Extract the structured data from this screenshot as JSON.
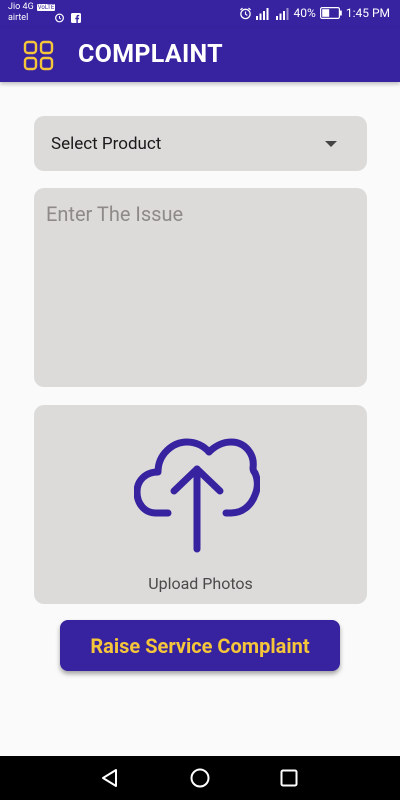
{
  "status_bar": {
    "carrier_1": "Jio 4G",
    "volte_badge": "VoLTE",
    "carrier_2": "airtel",
    "network_type": "4G",
    "battery_percent": "40%",
    "time": "1:45 PM"
  },
  "app_bar": {
    "title": "COMPLAINT",
    "menu_icon": "grid-icon"
  },
  "form": {
    "product_select": {
      "selected_value": "Select Product"
    },
    "issue_input": {
      "placeholder": "Enter The Issue",
      "value": ""
    },
    "upload": {
      "icon": "cloud-upload-icon",
      "label": "Upload Photos"
    },
    "submit_label": "Raise Service Complaint"
  },
  "colors": {
    "primary": "#3723a0",
    "accent": "#f5c53a",
    "field_background": "#dddbda",
    "page_background": "#fafafa"
  },
  "nav_bar": {
    "back_icon": "back-triangle-icon",
    "home_icon": "home-circle-icon",
    "recents_icon": "recents-square-icon"
  }
}
